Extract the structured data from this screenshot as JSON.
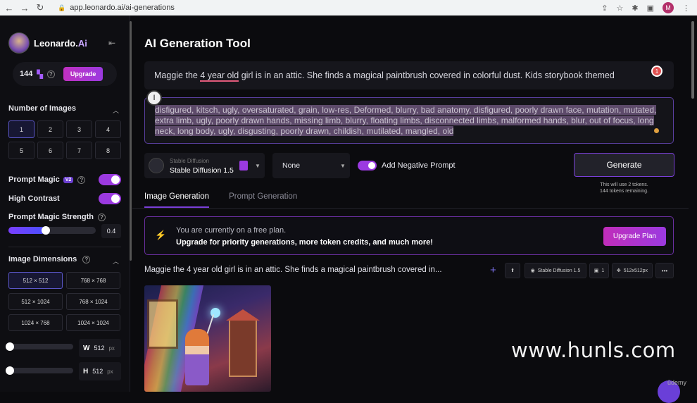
{
  "browser": {
    "url": "app.leonardo.ai/ai-generations",
    "avatar": "M"
  },
  "sidebar": {
    "brand_a": "Leonardo.",
    "brand_b": "Ai",
    "tokens": "144",
    "upgrade": "Upgrade",
    "num_images_title": "Number of Images",
    "num_options": [
      "1",
      "2",
      "3",
      "4",
      "5",
      "6",
      "7",
      "8"
    ],
    "selected_num": "1",
    "prompt_magic": "Prompt Magic",
    "prompt_magic_badge": "V2",
    "high_contrast": "High Contrast",
    "magic_strength": "Prompt Magic Strength",
    "magic_strength_value": "0.4",
    "image_dimensions": "Image Dimensions",
    "dimensions": [
      "512 × 512",
      "768 × 768",
      "512 × 1024",
      "768 × 1024",
      "1024 × 768",
      "1024 × 1024"
    ],
    "selected_dim": "512 × 512",
    "width_label": "W",
    "width": "512",
    "height_label": "H",
    "height": "512",
    "unit": "px"
  },
  "main": {
    "title": "AI Generation Tool",
    "prompt_before": "Maggie the ",
    "prompt_underlined": "4 year old",
    "prompt_after": " girl is in an attic. She finds a magical paintbrush covered in colorful dust. Kids storybook themed",
    "prompt_badge": "1",
    "negative_prompt": "disfigured, kitsch, ugly, oversaturated, grain, low-res, Deformed, blurry, bad anatomy, disfigured, poorly drawn face, mutation, mutated, extra limb, ugly, poorly drawn hands, missing limb, blurry, floating limbs, disconnected limbs, malformed hands, blur, out of focus, long neck, long body, ugly, disgusting, poorly drawn, childish, mutilated, mangled, old",
    "model_small": "Stable Diffusion",
    "model": "Stable Diffusion 1.5",
    "style": "None",
    "add_negative": "Add Negative Prompt",
    "generate": "Generate",
    "gen_note_1": "This will use 2 tokens.",
    "gen_note_2": "144 tokens remaining.",
    "tabs": [
      "Image Generation",
      "Prompt Generation"
    ],
    "banner_line1": "You are currently on a free plan.",
    "banner_line2": "Upgrade for priority generations, more token credits, and much more!",
    "upgrade_plan": "Upgrade Plan",
    "gen_heading": "Maggie the 4 year old girl is in an attic. She finds a magical paintbrush covered in...",
    "chip_model": "Stable Diffusion 1.5",
    "chip_count": "1",
    "chip_size": "512x512px",
    "more": "•••"
  },
  "watermark": "www.hunls.com",
  "udemy": "ūdemy",
  "colors": {
    "accent": "#9b3ae0",
    "brand": "#7a3fd8",
    "badge": "#e05050"
  }
}
